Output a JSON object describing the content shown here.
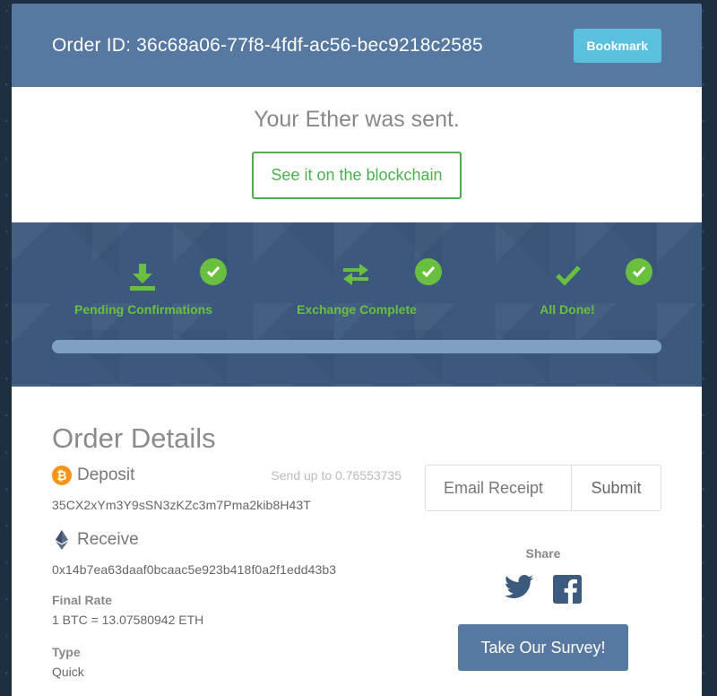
{
  "header": {
    "order_id": "Order ID: 36c68a06-77f8-4fdf-ac56-bec9218c2585",
    "bookmark_label": "Bookmark"
  },
  "status": {
    "title": "Your Ether was sent.",
    "blockchain_label": "See it on the blockchain"
  },
  "progress": {
    "steps": [
      {
        "label": "Pending Confirmations",
        "icon": "download-icon",
        "done": true
      },
      {
        "label": "Exchange Complete",
        "icon": "exchange-arrows-icon",
        "done": true
      },
      {
        "label": "All Done!",
        "icon": "checkmark-icon",
        "done": true
      }
    ],
    "percent": 100
  },
  "details": {
    "title": "Order Details",
    "deposit": {
      "label": "Deposit",
      "icon": "bitcoin-icon",
      "hint": "Send up to 0.76553735",
      "address": "35CX2xYm3Y9sSN3zKZc3m7Pma2kib8H43T"
    },
    "receive": {
      "label": "Receive",
      "icon": "ethereum-icon",
      "address": "0x14b7ea63daaf0bcaac5e923b418f0a2f1edd43b3"
    },
    "final_rate": {
      "label": "Final Rate",
      "value": "1 BTC = 13.07580942 ETH"
    },
    "type": {
      "label": "Type",
      "value": "Quick"
    }
  },
  "receipt": {
    "email_placeholder": "Email Receipt",
    "submit_label": "Submit"
  },
  "share": {
    "label": "Share",
    "icons": [
      "twitter-icon",
      "facebook-icon"
    ]
  },
  "survey": {
    "label": "Take Our Survey!"
  },
  "colors": {
    "header": "#5778a0",
    "accent_green": "#6abf3f",
    "bookmark": "#5bc0de",
    "bitcoin": "#f7931a"
  }
}
